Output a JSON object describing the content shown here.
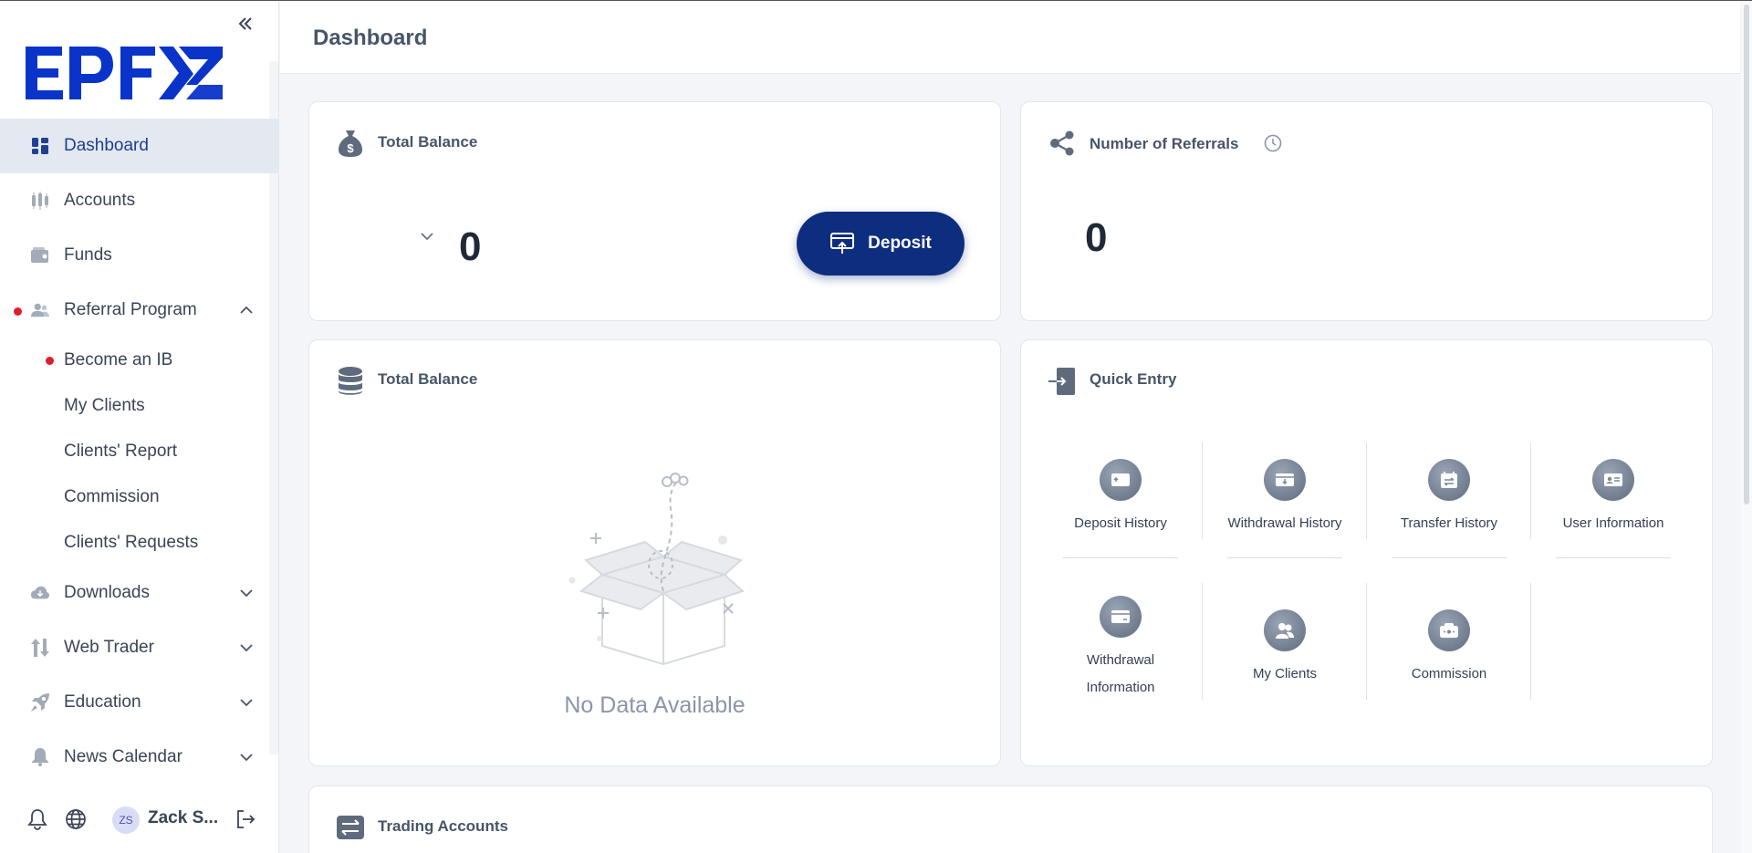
{
  "brand": {
    "logo_text": "EPFX",
    "color": "#0a34c9"
  },
  "header": {
    "title": "Dashboard"
  },
  "sidebar": {
    "items": [
      {
        "label": "Dashboard",
        "icon": "dashboard-icon",
        "active": true
      },
      {
        "label": "Accounts",
        "icon": "accounts-icon"
      },
      {
        "label": "Funds",
        "icon": "wallet-icon"
      },
      {
        "label": "Referral Program",
        "icon": "users-icon",
        "expanded": true,
        "badge": true
      }
    ],
    "referral_sub": [
      {
        "label": "Become an IB",
        "badge": true
      },
      {
        "label": "My Clients"
      },
      {
        "label": "Clients' Report"
      },
      {
        "label": "Commission"
      },
      {
        "label": "Clients' Requests"
      }
    ],
    "more_items": [
      {
        "label": "Downloads",
        "icon": "cloud-download-icon"
      },
      {
        "label": "Web Trader",
        "icon": "web-trader-icon"
      },
      {
        "label": "Education",
        "icon": "rocket-icon"
      },
      {
        "label": "News Calendar",
        "icon": "bell-icon"
      }
    ],
    "user": {
      "initials": "ZS",
      "name": "Zack S..."
    }
  },
  "balance_card": {
    "title": "Total Balance",
    "value": "0",
    "deposit_label": "Deposit"
  },
  "referrals_card": {
    "title": "Number of Referrals",
    "value": "0"
  },
  "balance_chart_card": {
    "title": "Total Balance",
    "empty_text": "No Data Available"
  },
  "quick_entry": {
    "title": "Quick Entry",
    "items": [
      {
        "label": "Deposit History",
        "icon": "deposit-history-icon"
      },
      {
        "label": "Withdrawal History",
        "icon": "withdrawal-history-icon"
      },
      {
        "label": "Transfer History",
        "icon": "transfer-history-icon"
      },
      {
        "label": "User Information",
        "icon": "user-info-icon"
      },
      {
        "label": "Withdrawal Information",
        "icon": "withdrawal-info-icon"
      },
      {
        "label": "My Clients",
        "icon": "my-clients-icon"
      },
      {
        "label": "Commission",
        "icon": "commission-icon"
      }
    ]
  },
  "trading_accounts": {
    "title": "Trading Accounts"
  }
}
